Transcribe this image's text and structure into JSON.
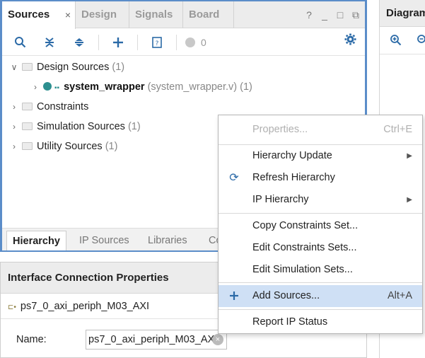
{
  "sources": {
    "tabs": [
      {
        "label": "Sources",
        "close": "×"
      },
      {
        "label": "Design"
      },
      {
        "label": "Signals"
      },
      {
        "label": "Board"
      }
    ],
    "window_controls": {
      "help": "?",
      "minimize": "_",
      "maximize": "□",
      "float": "⧉"
    },
    "toolbar": {
      "status_count": "0"
    },
    "tree": {
      "design_sources": {
        "label": "Design Sources",
        "count": "(1)"
      },
      "wrapper": {
        "name": "system_wrapper",
        "file": "(system_wrapper.v)",
        "count": "(1)"
      },
      "constraints": {
        "label": "Constraints"
      },
      "simulation": {
        "label": "Simulation Sources",
        "count": "(1)"
      },
      "utility": {
        "label": "Utility Sources",
        "count": "(1)"
      }
    },
    "bottom_tabs": [
      "Hierarchy",
      "IP Sources",
      "Libraries",
      "Co"
    ]
  },
  "diagram": {
    "title": "Diagram"
  },
  "props": {
    "title": "Interface Connection Properties",
    "object": "ps7_0_axi_periph_M03_AXI",
    "name_label": "Name:",
    "name_value": "ps7_0_axi_periph_M03_AXI"
  },
  "menu": {
    "items": [
      {
        "label": "Properties...",
        "shortcut": "Ctrl+E"
      },
      {
        "label": "Hierarchy Update"
      },
      {
        "label": "Refresh Hierarchy"
      },
      {
        "label": "IP Hierarchy"
      },
      {
        "label": "Copy Constraints Set..."
      },
      {
        "label": "Edit Constraints Sets..."
      },
      {
        "label": "Edit Simulation Sets..."
      },
      {
        "label": "Add Sources...",
        "shortcut": "Alt+A"
      },
      {
        "label": "Report IP Status"
      }
    ]
  },
  "colors": {
    "accent": "#2b6aa7",
    "focus_border": "#5b8dc9",
    "menu_highlight": "#cfe0f5"
  }
}
